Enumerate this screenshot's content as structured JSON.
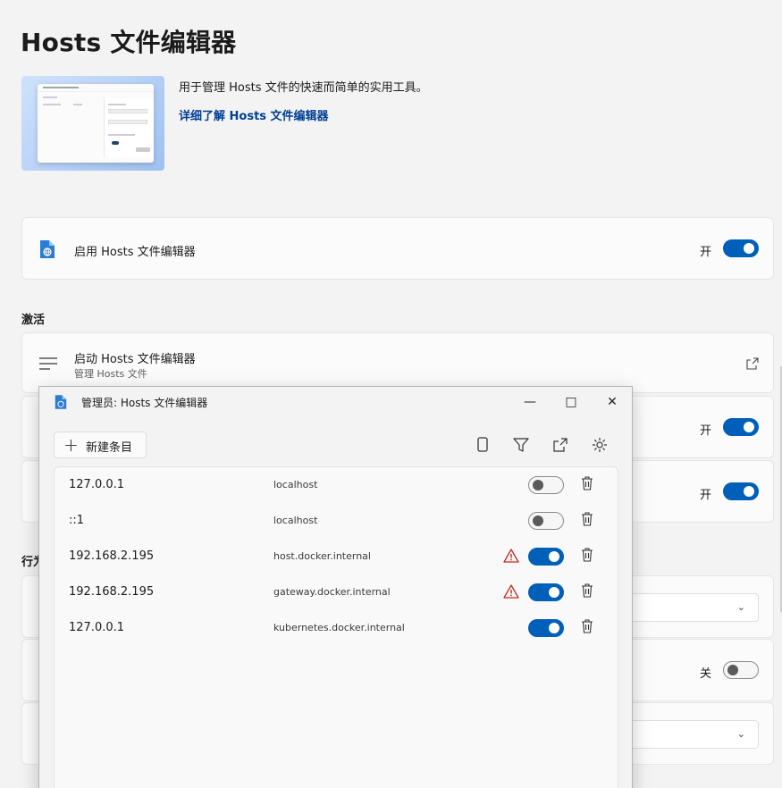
{
  "page": {
    "title": "Hosts 文件编辑器",
    "description": "用于管理 Hosts 文件的快速而简单的实用工具。",
    "learn_more": "详细了解 Hosts 文件编辑器"
  },
  "enable_card": {
    "title": "启用 Hosts 文件编辑器",
    "toggle_label": "开",
    "toggle_on": true
  },
  "activation_section": {
    "label": "激活",
    "launch": {
      "title": "启动 Hosts 文件编辑器",
      "subtitle": "管理 Hosts 文件"
    },
    "toggle_rows": [
      {
        "label": "开",
        "on": true
      },
      {
        "label": "开",
        "on": true
      }
    ]
  },
  "behavior_section": {
    "label": "行为",
    "toggle": {
      "label": "关",
      "on": false
    }
  },
  "editor_window": {
    "title": "管理员: Hosts 文件编辑器",
    "new_entry": "新建条目",
    "controls": {
      "minimize": "—",
      "maximize": "□",
      "close": "✕"
    },
    "toolbar_icons": [
      "copy-icon",
      "filter-icon",
      "open-external-icon",
      "settings-icon"
    ],
    "entries": [
      {
        "ip": "127.0.0.1",
        "host": "localhost",
        "enabled": false,
        "warning": false
      },
      {
        "ip": "::1",
        "host": "localhost",
        "enabled": false,
        "warning": false
      },
      {
        "ip": "192.168.2.195",
        "host": "host.docker.internal",
        "enabled": true,
        "warning": true
      },
      {
        "ip": "192.168.2.195",
        "host": "gateway.docker.internal",
        "enabled": true,
        "warning": true
      },
      {
        "ip": "127.0.0.1",
        "host": "kubernetes.docker.internal",
        "enabled": true,
        "warning": false
      }
    ]
  },
  "colors": {
    "accent": "#005fb8",
    "link": "#003e92",
    "warning": "#c42b1c",
    "background": "#f3f3f3",
    "card": "#fbfbfb"
  }
}
